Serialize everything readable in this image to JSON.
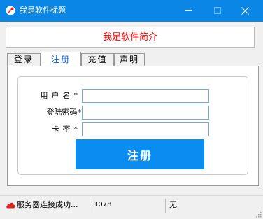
{
  "window": {
    "title": "我是软件标题",
    "icon": "app-logo-icon",
    "controls": [
      "minimize-icon",
      "maximize-icon",
      "close-icon"
    ]
  },
  "intro": {
    "text": "我是软件简介",
    "color": "#ff0000"
  },
  "tabs": [
    {
      "label": "登录",
      "active": false
    },
    {
      "label": "注册",
      "active": true
    },
    {
      "label": "充值",
      "active": false
    },
    {
      "label": "声明",
      "active": false
    }
  ],
  "form": {
    "username_label": "用户名*",
    "password_label": "登陆密码*",
    "card_label": "卡密*",
    "username_value": "",
    "password_value": "",
    "card_value": "",
    "submit_label": "注册"
  },
  "status": {
    "message": "服务器连接成功...",
    "count": "1078",
    "extra": "无",
    "icon": "cloud-icon"
  },
  "colors": {
    "titlebar": "#0a86e6",
    "button": "#0a8cf0",
    "active_tab_text": "#0055cc"
  }
}
